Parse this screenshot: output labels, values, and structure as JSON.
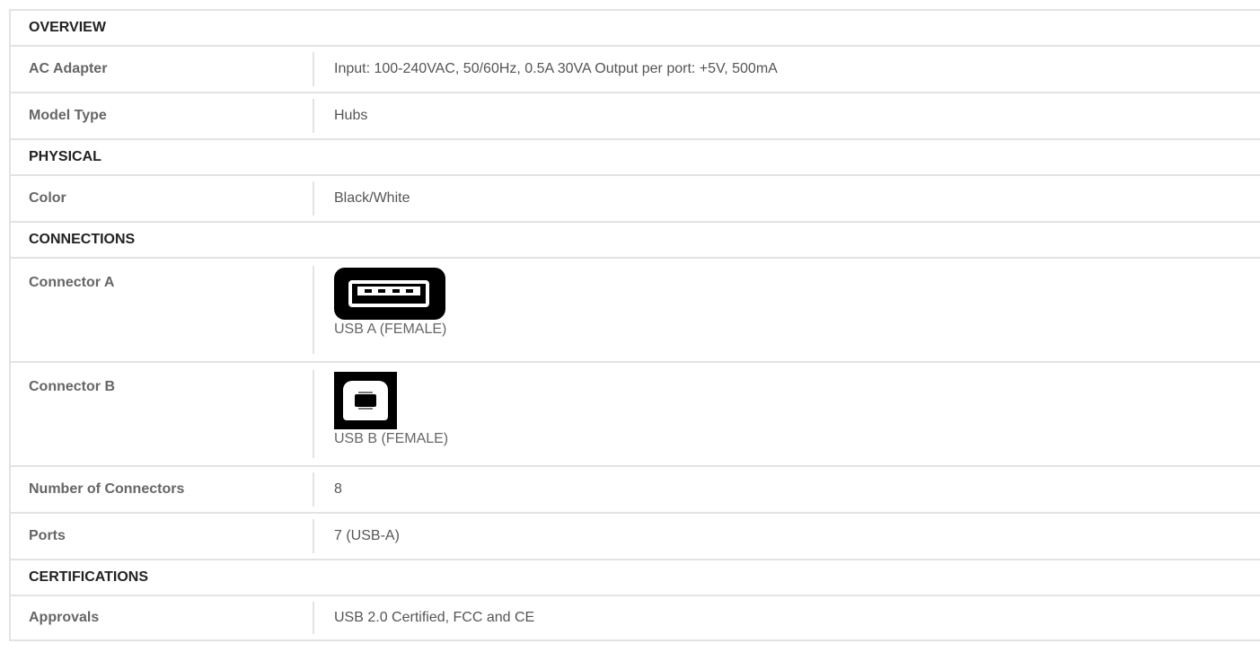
{
  "sections": [
    {
      "title": "OVERVIEW",
      "rows": [
        {
          "label": "AC Adapter",
          "value": "Input: 100-240VAC, 50/60Hz, 0.5A 30VA Output per port: +5V, 500mA"
        },
        {
          "label": "Model Type",
          "value": "Hubs"
        }
      ]
    },
    {
      "title": "PHYSICAL",
      "rows": [
        {
          "label": "Color",
          "value": "Black/White"
        }
      ]
    },
    {
      "title": "CONNECTIONS",
      "rows": [
        {
          "label": "Connector A",
          "value": "USB A (FEMALE)",
          "icon": "usb-a-female-icon"
        },
        {
          "label": "Connector B",
          "value": "USB B (FEMALE)",
          "icon": "usb-b-female-icon"
        },
        {
          "label": "Number of Connectors",
          "value": "8"
        },
        {
          "label": "Ports",
          "value": "7 (USB-A)"
        }
      ]
    },
    {
      "title": "CERTIFICATIONS",
      "rows": [
        {
          "label": "Approvals",
          "value": "USB 2.0 Certified, FCC and CE"
        }
      ]
    }
  ]
}
